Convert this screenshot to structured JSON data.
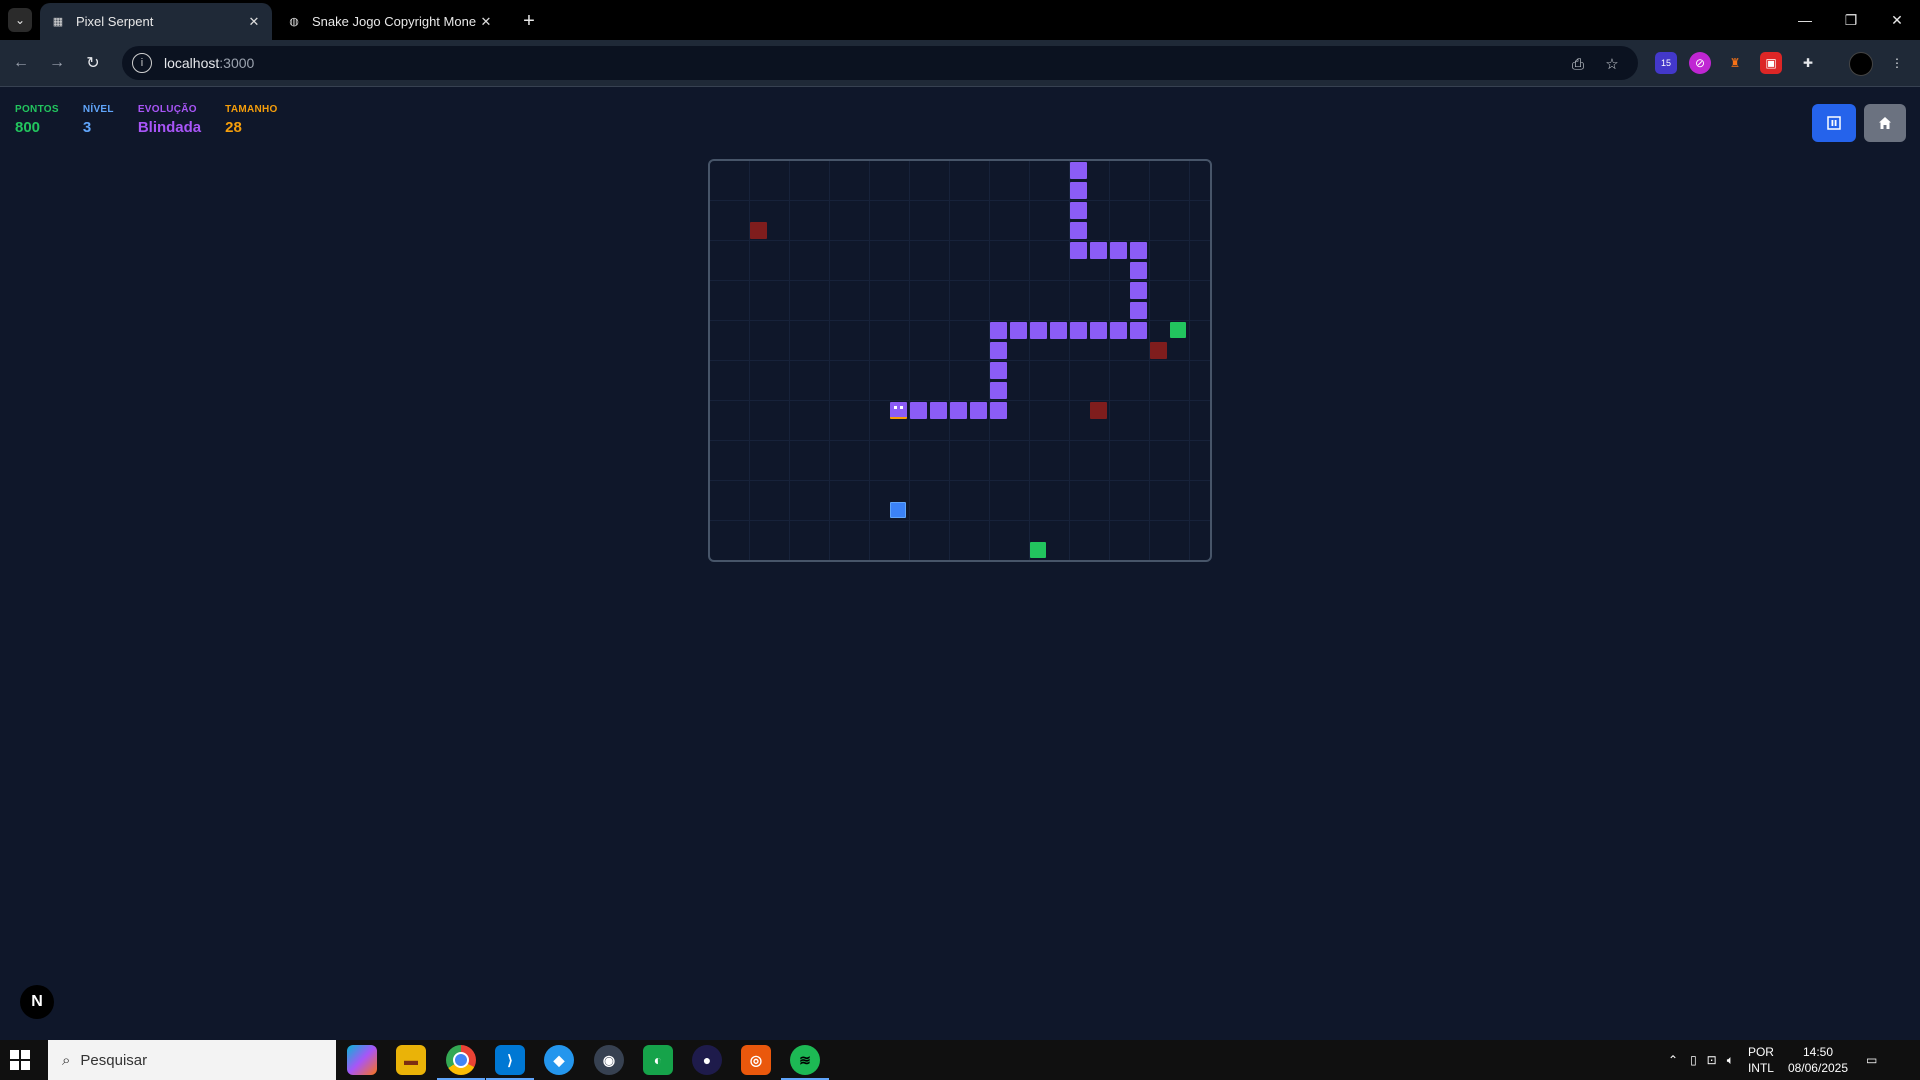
{
  "browser": {
    "tabs": [
      {
        "title": "Pixel Serpent",
        "active": true
      },
      {
        "title": "Snake Jogo Copyright Monetiza",
        "active": false
      }
    ],
    "url_host": "localhost",
    "url_port": ":3000",
    "extension_badge": "15"
  },
  "hud": {
    "points_label": "PONTOS",
    "points_value": "800",
    "level_label": "NÍVEL",
    "level_value": "3",
    "evolution_label": "EVOLUÇÃO",
    "evolution_value": "Blindada",
    "size_label": "TAMANHO",
    "size_value": "28"
  },
  "colors": {
    "points": "#22c55e",
    "level": "#60a5fa",
    "evolution": "#a855f7",
    "size": "#f59e0b",
    "snake": "#8b5cf6",
    "food": "#22c55e",
    "obstacle": "#7f1d1d",
    "powerup": "#3b82f6"
  },
  "game": {
    "grid_cols": 25,
    "grid_rows": 20,
    "snake": [
      [
        9,
        12
      ],
      [
        10,
        12
      ],
      [
        11,
        12
      ],
      [
        12,
        12
      ],
      [
        13,
        12
      ],
      [
        14,
        11
      ],
      [
        14,
        10
      ],
      [
        14,
        9
      ],
      [
        14,
        8
      ],
      [
        15,
        8
      ],
      [
        16,
        8
      ],
      [
        17,
        8
      ],
      [
        18,
        8
      ],
      [
        19,
        8
      ],
      [
        20,
        8
      ],
      [
        21,
        7
      ],
      [
        21,
        6
      ],
      [
        21,
        5
      ],
      [
        21,
        4
      ],
      [
        20,
        4
      ],
      [
        19,
        4
      ],
      [
        18,
        4
      ],
      [
        18,
        3
      ],
      [
        18,
        2
      ],
      [
        18,
        1
      ],
      [
        18,
        0
      ],
      [
        14,
        12
      ],
      [
        21,
        8
      ]
    ],
    "foods": [
      [
        23,
        8
      ],
      [
        16,
        19
      ]
    ],
    "obstacles": [
      [
        2,
        3
      ],
      [
        22,
        9
      ],
      [
        19,
        12
      ]
    ],
    "powerups": [
      [
        9,
        17
      ]
    ]
  },
  "page": {
    "nextjs_badge": "N"
  },
  "taskbar": {
    "search_placeholder": "Pesquisar",
    "lang_top": "POR",
    "lang_bottom": "INTL",
    "time": "14:50",
    "date": "08/06/2025"
  }
}
